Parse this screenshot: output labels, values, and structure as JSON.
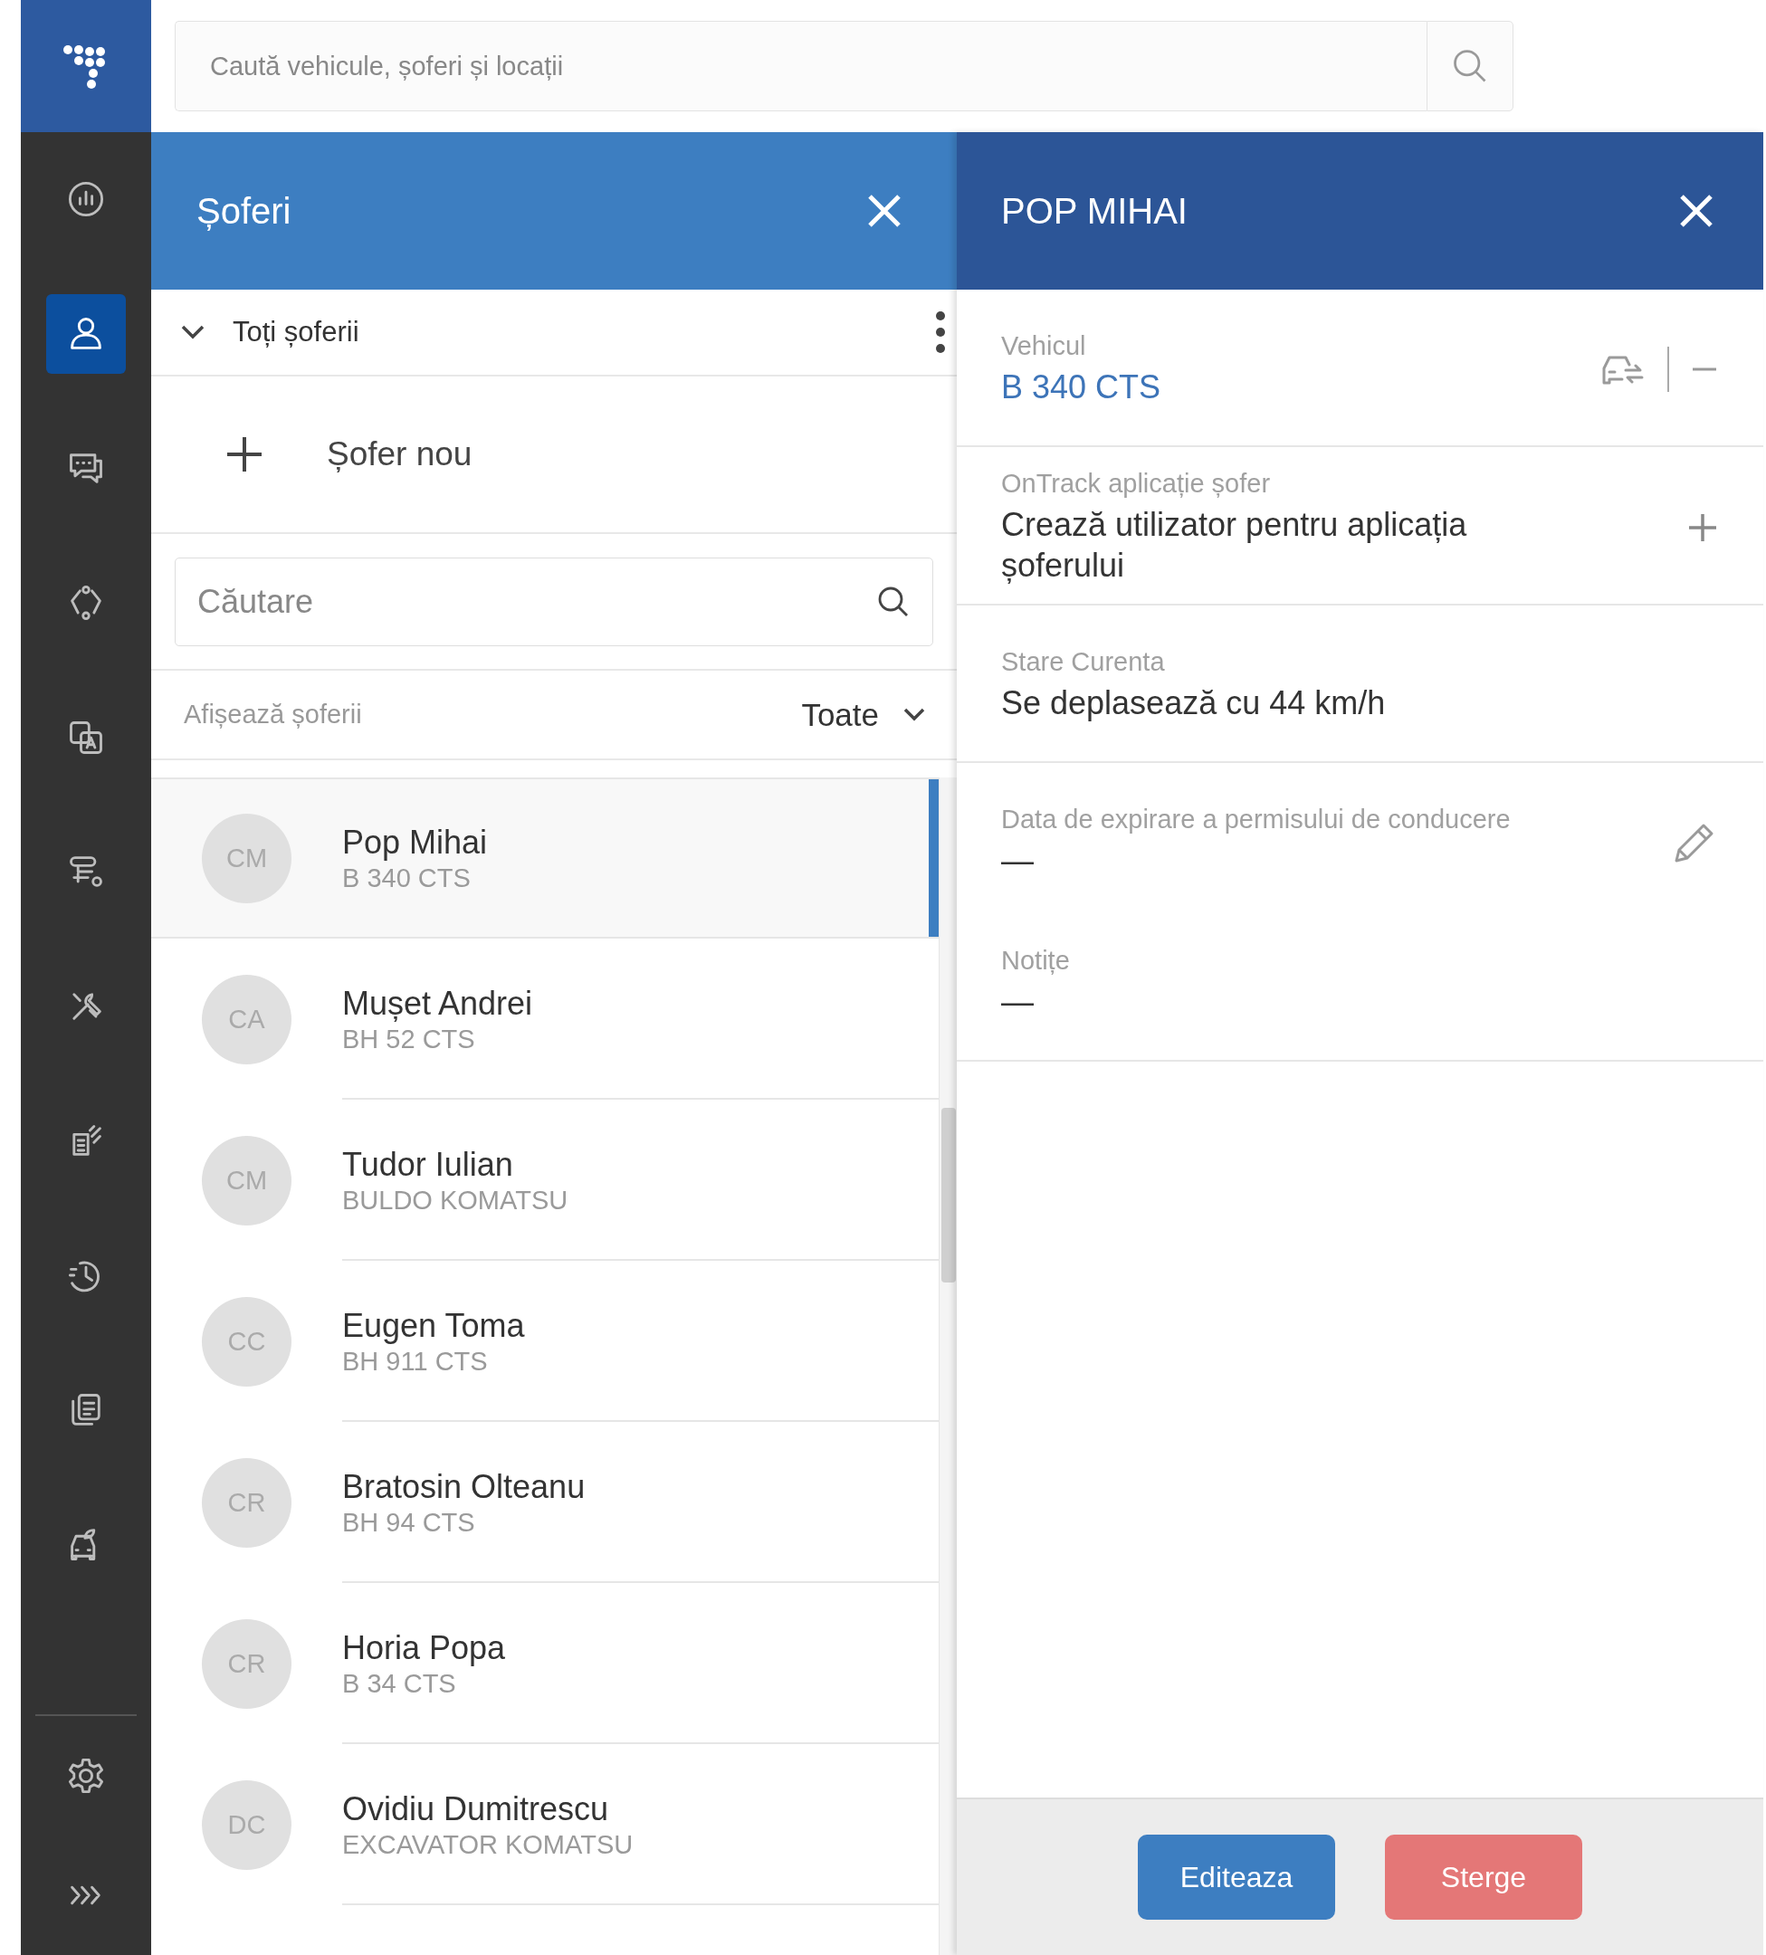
{
  "search": {
    "placeholder": "Caută vehicule, șoferi și locații"
  },
  "nav": [
    {
      "kind": "chart",
      "selected": false
    },
    {
      "kind": "person",
      "selected": true
    },
    {
      "kind": "chat",
      "selected": false
    },
    {
      "kind": "cycle",
      "selected": false
    },
    {
      "kind": "translate",
      "selected": false
    },
    {
      "kind": "route",
      "selected": false
    },
    {
      "kind": "tools",
      "selected": false
    },
    {
      "kind": "signal-doc",
      "selected": false
    },
    {
      "kind": "history",
      "selected": false
    },
    {
      "kind": "copy",
      "selected": false
    },
    {
      "kind": "car",
      "selected": false
    }
  ],
  "nav_bottom": [
    {
      "kind": "settings"
    },
    {
      "kind": "expand"
    }
  ],
  "drivers_panel": {
    "title": "Șoferi",
    "group": "Toți șoferii",
    "new_driver": "Șofer nou",
    "search": {
      "placeholder": "Căutare"
    },
    "filter": {
      "label": "Afișează șoferii",
      "value": "Toate"
    },
    "drivers": [
      {
        "initials": "CM",
        "name": "Pop Mihai",
        "vehicle": "B 340 CTS",
        "selected": true
      },
      {
        "initials": "CA",
        "name": "Mușet Andrei",
        "vehicle": "BH 52 CTS",
        "selected": false
      },
      {
        "initials": "CM",
        "name": "Tudor Iulian",
        "vehicle": "BULDO KOMATSU",
        "selected": false
      },
      {
        "initials": "CC",
        "name": "Eugen Toma",
        "vehicle": "BH 911 CTS",
        "selected": false
      },
      {
        "initials": "CR",
        "name": "Bratosin Olteanu",
        "vehicle": "BH 94 CTS",
        "selected": false
      },
      {
        "initials": "CR",
        "name": "Horia Popa",
        "vehicle": "B 34 CTS",
        "selected": false
      },
      {
        "initials": "DC",
        "name": "Ovidiu Dumitrescu",
        "vehicle": "EXCAVATOR KOMATSU",
        "selected": false
      }
    ]
  },
  "details": {
    "title": "POP MIHAI",
    "sections": [
      {
        "fields": [
          {
            "kind": "vehicle",
            "label": "Vehicul",
            "value": "B 340 CTS"
          }
        ]
      },
      {
        "fields": [
          {
            "kind": "action",
            "label": "OnTrack aplicație șofer",
            "value": "Crează utilizator pentru aplicația șoferului"
          }
        ]
      },
      {
        "fields": [
          {
            "kind": "text",
            "label": "Stare Curenta",
            "value": "Se deplasează cu 44 km/h"
          }
        ]
      },
      {
        "fields": [
          {
            "kind": "editable",
            "label": "Data de expirare a permisului de conducere",
            "value": "—"
          },
          {
            "kind": "text",
            "label": "Notițe",
            "value": "—"
          }
        ]
      }
    ],
    "buttons": [
      {
        "kind": "primary",
        "label": "Editeaza"
      },
      {
        "kind": "danger",
        "label": "Sterge"
      }
    ]
  }
}
